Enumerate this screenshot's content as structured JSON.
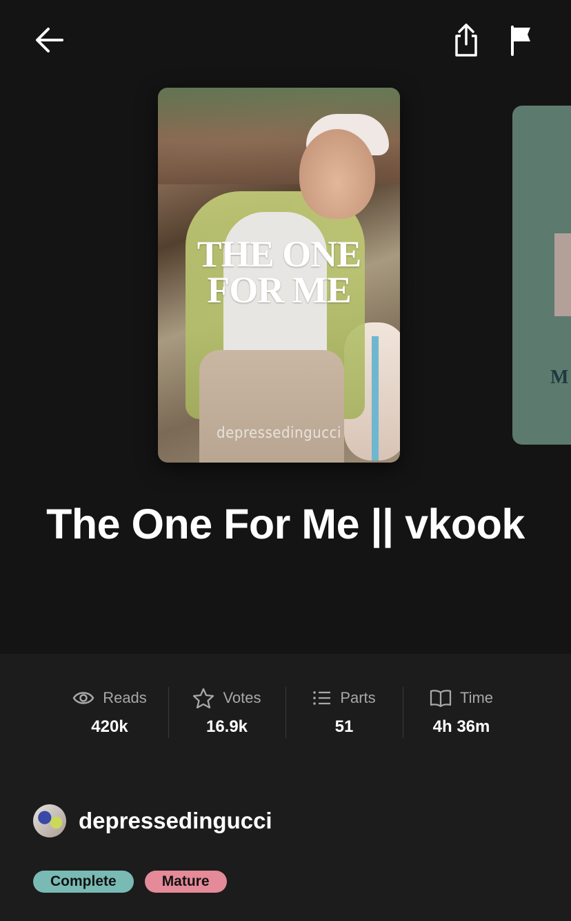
{
  "icons": {
    "back": "arrow-left-icon",
    "share": "share-icon",
    "flag": "flag-icon",
    "reads": "eye-icon",
    "votes": "star-icon",
    "parts": "list-icon",
    "time": "book-icon"
  },
  "cover": {
    "title_line1": "THE ONE",
    "title_line2": "FOR ME",
    "author_mark": "depressedingucci"
  },
  "next_cover": {
    "text": "M"
  },
  "story": {
    "title": "The One For Me || vkook"
  },
  "stats": [
    {
      "label": "Reads",
      "value": "420k"
    },
    {
      "label": "Votes",
      "value": "16.9k"
    },
    {
      "label": "Parts",
      "value": "51"
    },
    {
      "label": "Time",
      "value": "4h 36m"
    }
  ],
  "author": {
    "name": "depressedingucci"
  },
  "tags": [
    {
      "label": "Complete",
      "color": "#79bab5"
    },
    {
      "label": "Mature",
      "color": "#e48a98"
    }
  ],
  "colors": {
    "background": "#121212",
    "panel": "#1c1c1c"
  }
}
